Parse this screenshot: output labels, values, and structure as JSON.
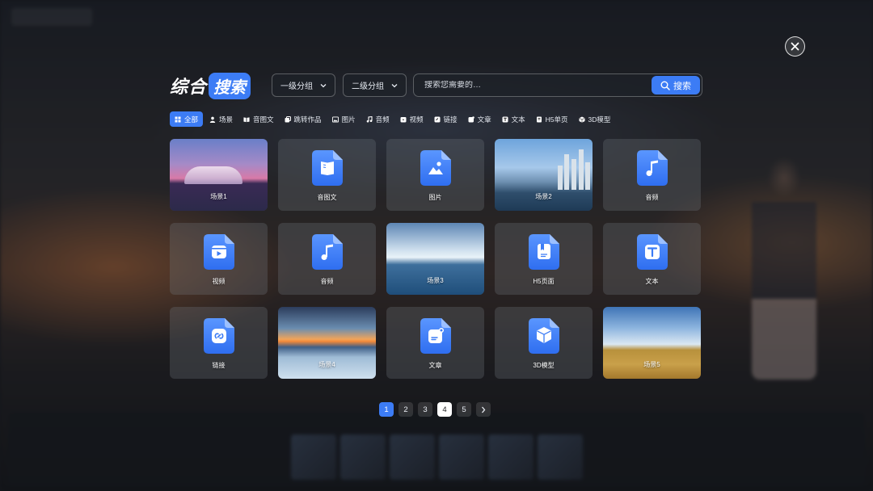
{
  "header": {
    "logo_part1": "综合",
    "logo_part2": "搜索",
    "select_level1": "一级分组",
    "select_level2": "二级分组",
    "search_placeholder": "搜索您需要的…",
    "search_button": "搜索"
  },
  "tabs": [
    {
      "label": "全部",
      "icon": "grid-icon",
      "active": true
    },
    {
      "label": "场景",
      "icon": "person-icon"
    },
    {
      "label": "音图文",
      "icon": "book-icon"
    },
    {
      "label": "跳转作品",
      "icon": "jump-icon"
    },
    {
      "label": "图片",
      "icon": "image-icon"
    },
    {
      "label": "音频",
      "icon": "music-icon"
    },
    {
      "label": "视频",
      "icon": "video-icon"
    },
    {
      "label": "链接",
      "icon": "link-icon"
    },
    {
      "label": "文章",
      "icon": "article-icon"
    },
    {
      "label": "文本",
      "icon": "text-icon"
    },
    {
      "label": "H5单页",
      "icon": "h5-icon"
    },
    {
      "label": "3D模型",
      "icon": "cube-icon"
    }
  ],
  "cards": [
    {
      "label": "场景1",
      "kind": "photo",
      "photo": "p1"
    },
    {
      "label": "音图文",
      "kind": "icon",
      "icon": "book-icon"
    },
    {
      "label": "图片",
      "kind": "icon",
      "icon": "image-icon"
    },
    {
      "label": "场景2",
      "kind": "photo",
      "photo": "p2"
    },
    {
      "label": "音频",
      "kind": "icon",
      "icon": "music-icon"
    },
    {
      "label": "视频",
      "kind": "icon",
      "icon": "video-icon"
    },
    {
      "label": "音频",
      "kind": "icon",
      "icon": "music-icon"
    },
    {
      "label": "场景3",
      "kind": "photo",
      "photo": "p3"
    },
    {
      "label": "H5页面",
      "kind": "icon",
      "icon": "h5-icon"
    },
    {
      "label": "文本",
      "kind": "icon",
      "icon": "text-icon"
    },
    {
      "label": "链接",
      "kind": "icon",
      "icon": "link-icon"
    },
    {
      "label": "场景4",
      "kind": "photo",
      "photo": "p4"
    },
    {
      "label": "文章",
      "kind": "icon",
      "icon": "article-icon"
    },
    {
      "label": "3D模型",
      "kind": "icon",
      "icon": "cube-icon"
    },
    {
      "label": "场景5",
      "kind": "photo",
      "photo": "p5"
    }
  ],
  "pagination": {
    "pages": [
      "1",
      "2",
      "3",
      "4",
      "5"
    ],
    "current": "4"
  },
  "colors": {
    "accent": "#3c7cf5"
  }
}
